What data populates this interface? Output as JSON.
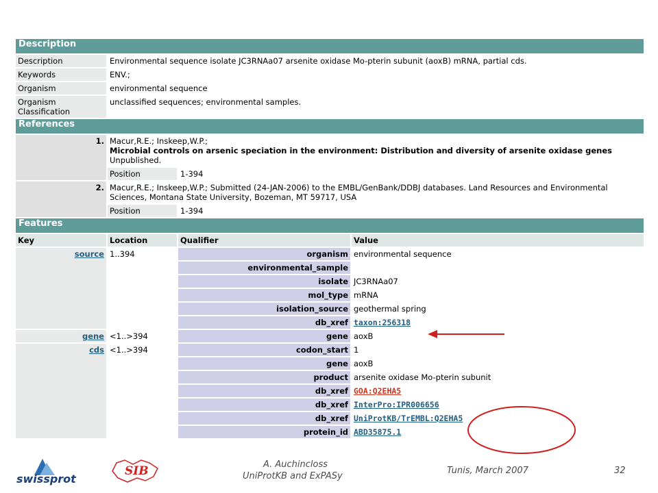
{
  "description": {
    "section_title": "Description",
    "rows": [
      {
        "label": "Description",
        "value": "Environmental sequence isolate JC3RNAa07 arsenite oxidase Mo-pterin subunit (aoxB) mRNA, partial cds."
      },
      {
        "label": "Keywords",
        "value": "ENV.;"
      },
      {
        "label": "Organism",
        "value": "environmental sequence"
      },
      {
        "label": "Organism Classification",
        "value": "unclassified sequences; environmental samples."
      }
    ]
  },
  "references": {
    "section_title": "References",
    "items": [
      {
        "number": "1.",
        "authors": "Macur,R.E.; Inskeep,W.P.;",
        "title": "Microbial controls on arsenic speciation in the environment: Distribution and diversity of arsenite oxidase genes",
        "journal": "Unpublished.",
        "position_label": "Position",
        "position": "1-394"
      },
      {
        "number": "2.",
        "authors": "Macur,R.E.; Inskeep,W.P.; Submitted (24-JAN-2006) to the EMBL/GenBank/DDBJ databases. Land Resources and Environmental Sciences, Montana State University, Bozeman, MT 59717, USA",
        "position_label": "Position",
        "position": "1-394"
      }
    ]
  },
  "features": {
    "section_title": "Features",
    "headers": {
      "key": "Key",
      "location": "Location",
      "qualifier": "Qualifier",
      "value": "Value"
    },
    "source": {
      "key": "source",
      "location": "1..394",
      "qualifiers": [
        {
          "name": "organism",
          "value": "environmental sequence"
        },
        {
          "name": "environmental_sample",
          "value": ""
        },
        {
          "name": "isolate",
          "value": "JC3RNAa07"
        },
        {
          "name": "mol_type",
          "value": "mRNA"
        },
        {
          "name": "isolation_source",
          "value": "geothermal spring"
        },
        {
          "name": "db_xref",
          "value": "taxon:256318"
        }
      ]
    },
    "gene": {
      "key": "gene",
      "location": "<1..>394",
      "qualifiers": [
        {
          "name": "gene",
          "value": "aoxB"
        }
      ]
    },
    "cds": {
      "key": "cds",
      "location": "<1..>394",
      "qualifiers": [
        {
          "name": "codon_start",
          "value": "1"
        },
        {
          "name": "gene",
          "value": "aoxB"
        },
        {
          "name": "product",
          "value": "arsenite oxidase Mo-pterin subunit"
        },
        {
          "name": "db_xref",
          "value": "GOA:Q2EHA5"
        },
        {
          "name": "db_xref",
          "value": "InterPro:IPR006656"
        },
        {
          "name": "db_xref",
          "value": "UniProtKB/TrEMBL:Q2EHA5"
        },
        {
          "name": "protein_id",
          "value": "ABD35875.1"
        }
      ]
    }
  },
  "footer": {
    "logo_left": "swissprot",
    "logo_center": "SIB",
    "author": "A. Auchincloss",
    "subtitle": "UniProtKB and ExPASy",
    "place_date": "Tunis, March 2007",
    "page_number": "32"
  },
  "colors": {
    "section_header": "#5f9b98",
    "qualifier_bg": "#cfcfe8",
    "link": "#1f5f83",
    "link_red": "#d0361f",
    "annotation": "#d01e1e"
  },
  "icons": [
    "arrow-annotation",
    "circle-annotation",
    "swissprot-logo",
    "sib-logo"
  ]
}
